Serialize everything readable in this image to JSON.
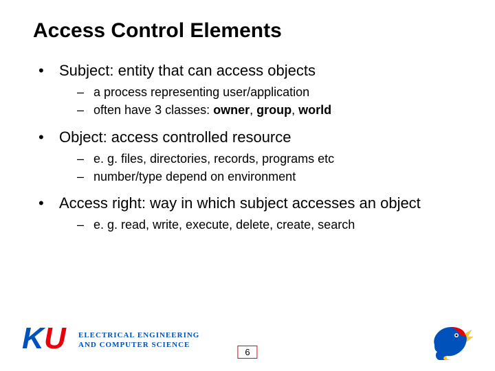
{
  "title": "Access Control Elements",
  "bullets": [
    {
      "text": "Subject: entity that can access objects",
      "sub": [
        {
          "text": "a process representing user/application"
        },
        {
          "text_pre": "often have 3 classes: ",
          "bold1": "owner",
          "sep1": ", ",
          "bold2": "group",
          "sep2": ", ",
          "bold3": "world"
        }
      ]
    },
    {
      "text": "Object: access controlled resource",
      "sub": [
        {
          "text": "e. g. files, directories, records, programs etc"
        },
        {
          "text": "number/type depend on environment"
        }
      ]
    },
    {
      "text": "Access right: way in which subject accesses an object",
      "sub": [
        {
          "text": "e. g. read, write, execute, delete, create, search"
        }
      ]
    }
  ],
  "ku": {
    "k": "K",
    "u": "U",
    "dept_line1": "ELECTRICAL ENGINEERING",
    "dept_line2": "AND COMPUTER SCIENCE"
  },
  "page": "6"
}
